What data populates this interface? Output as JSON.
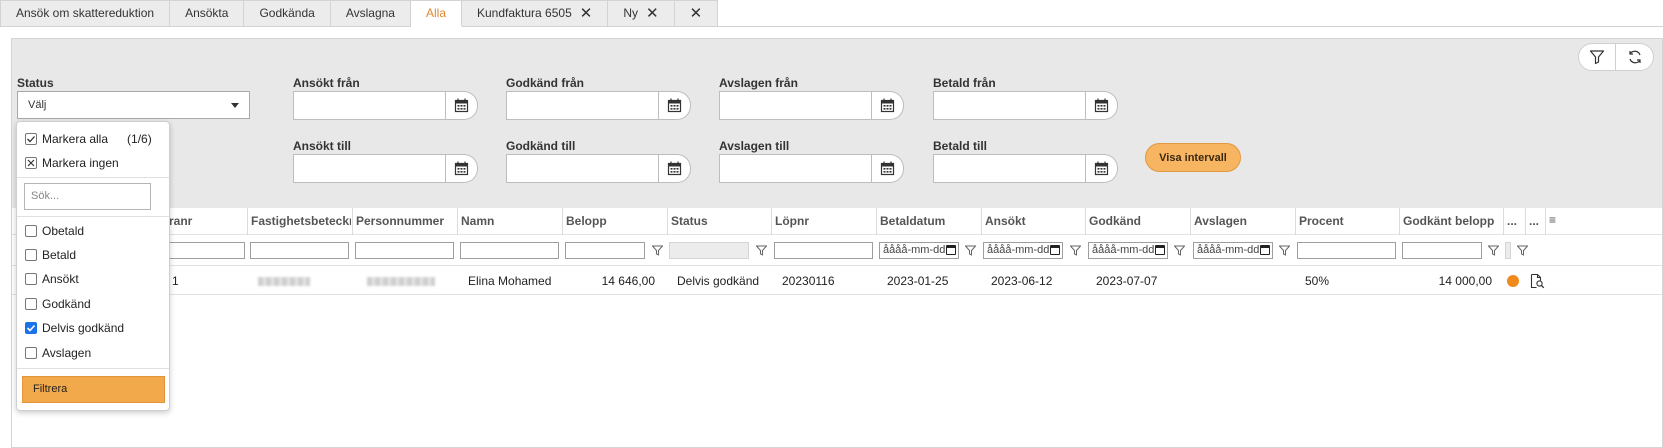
{
  "tabs": [
    {
      "label": "Ansök om skattereduktion",
      "active": false,
      "closable": false
    },
    {
      "label": "Ansökta",
      "active": false,
      "closable": false
    },
    {
      "label": "Godkända",
      "active": false,
      "closable": false
    },
    {
      "label": "Avslagna",
      "active": false,
      "closable": false
    },
    {
      "label": "Alla",
      "active": true,
      "closable": false
    },
    {
      "label": "Kundfaktura 6505",
      "active": false,
      "closable": true
    },
    {
      "label": "Ny",
      "active": false,
      "closable": true
    },
    {
      "label": "",
      "active": false,
      "closable": true
    }
  ],
  "filters": {
    "status_label": "Status",
    "status_value": "Välj",
    "ansokt_fran": "Ansökt från",
    "godkand_fran": "Godkänd från",
    "avslagen_fran": "Avslagen från",
    "betald_fran": "Betald från",
    "ansokt_till": "Ansökt till",
    "godkand_till": "Godkänd till",
    "avslagen_till": "Avslagen till",
    "betald_till": "Betald till",
    "visa_intervall": "Visa intervall"
  },
  "grid": {
    "columns": [
      "ranr",
      "Fastighetsbeteckning",
      "Personnummer",
      "Namn",
      "Belopp",
      "Status",
      "Löpnr",
      "Betaldatum",
      "Ansökt",
      "Godkänd",
      "Avslagen",
      "Procent",
      "Godkänt belopp",
      "...",
      "..."
    ],
    "date_placeholder": "åååå-mm-dd",
    "row": {
      "ranr": "1",
      "namn": "Elina Mohamed",
      "belopp": "14 646,00",
      "status": "Delvis godkänd",
      "lopnr": "20230116",
      "betaldatum": "2023-01-25",
      "ansokt": "2023-06-12",
      "godkand": "2023-07-07",
      "avslagen": "",
      "procent": "50%",
      "godkant_belopp": "14 000,00",
      "status_color": "#f08a1a"
    }
  },
  "dropdown": {
    "select_all": "Markera alla",
    "count": "(1/6)",
    "select_none": "Markera ingen",
    "search_placeholder": "Sök...",
    "options": [
      {
        "label": "Obetald",
        "checked": false
      },
      {
        "label": "Betald",
        "checked": false
      },
      {
        "label": "Ansökt",
        "checked": false
      },
      {
        "label": "Godkänd",
        "checked": false
      },
      {
        "label": "Delvis godkänd",
        "checked": true
      },
      {
        "label": "Avslagen",
        "checked": false
      }
    ],
    "filter_button": "Filtrera"
  },
  "colors": {
    "accent": "#e3872f",
    "button": "#f7b562"
  }
}
